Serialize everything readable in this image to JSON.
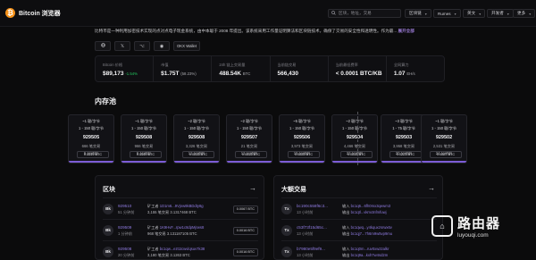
{
  "header": {
    "logo_glyph": "₿",
    "app_name": "Bitcoin 浏览器",
    "search_placeholder": "区块，地址，交易",
    "dropdowns": [
      {
        "label": "区块链"
      },
      {
        "label": "Rumes"
      },
      {
        "label": "英文"
      },
      {
        "label": "开发者"
      },
      {
        "label": "更多"
      }
    ]
  },
  "description": {
    "text": "比特币是一种利用加密技术实现的点对点电子现金系统，由中本聪于 2008 年提出。该系统采用工作量证明算法和区块链技术，确保了交易的安全性和透明性。作为最...",
    "more_label": "展开全部"
  },
  "social": {
    "x_glyph": "𝕏",
    "github_glyph": "⌥",
    "discord_glyph": "◉",
    "okx_label": "OKX Wallet"
  },
  "stats": [
    {
      "label": "Bitcoin 价格",
      "value": "$89,173",
      "delta": "-1.54%"
    },
    {
      "label": "市值",
      "value": "$1.75T",
      "unit": "(58.23%)"
    },
    {
      "label": "24h 链上交易量",
      "value": "488.54K",
      "unit": "BTC"
    },
    {
      "label": "当前链交易",
      "value": "566,430"
    },
    {
      "label": "当前最低费率",
      "value": "< 0.0001 BTC/KB"
    },
    {
      "label": "全网算力",
      "value": "1.07",
      "unit": "EH/s"
    }
  ],
  "mempool": {
    "title": "内存池",
    "blocks": [
      {
        "l1": "~1 聪/字节",
        "l2": "1 - 150 聪/字节",
        "num": "929505",
        "l4": "666 笔交易",
        "l5": "5 分钟前",
        "fee": "0.0059 BTC"
      },
      {
        "l1": "~1 聪/字节",
        "l2": "1 - 150 聪/字节",
        "num": "929508",
        "l4": "966 笔交易",
        "l5": "5 分钟前",
        "fee": "0.0069 BTC"
      },
      {
        "l1": "~2 聪/字节",
        "l2": "1 - 150 聪/字节",
        "num": "929508",
        "l4": "3,326 笔交易",
        "l5": "12 分钟前",
        "fee": "0.0016 BTC"
      },
      {
        "l1": "~2 聪/字节",
        "l2": "1 - 150 聪/字节",
        "num": "929507",
        "l4": "21 笔交易",
        "l5": "12 分钟前",
        "fee": "0.0016 BTC"
      },
      {
        "l1": "~5 聪/字节",
        "l2": "1 - 150 聪/字节",
        "num": "929506",
        "l4": "3,973 笔交易",
        "l5": "15 分钟前",
        "fee": "0.0039 BTC"
      },
      {
        "l1": "~2 聪/字节",
        "l2": "1 - 150 聪/字节",
        "num": "929504",
        "l4": "4,466 笔交易",
        "l5": "22 分钟前",
        "fee": "0.0016 BTC"
      },
      {
        "l1": "~3 聪/字节",
        "l2": "1 - 75 聪/字节",
        "num": "929503",
        "l4": "3,958 笔交易",
        "l5": "20 分钟前",
        "fee": "0.0223 BTC"
      },
      {
        "l1": "~1 聪/字节",
        "l2": "1 - 150 聪/字节",
        "num": "929502",
        "l4": "2,531 笔交易",
        "l5": "24 分钟前",
        "fee": "0.0087 BTC"
      }
    ]
  },
  "blocks_panel": {
    "title": "区块",
    "arrow": "→",
    "rows": [
      {
        "icon": "Bk",
        "height": "929510",
        "age": "51 分钟前",
        "miner_prefix": "矿工者",
        "miner": "1D1m6...9Vjnw9kBDdty8g",
        "txs": "3,155 笔交易",
        "reward": "3.1317468 BTC",
        "fee": "0.0067 BTC"
      },
      {
        "icon": "Bk",
        "height": "929509",
        "age": "1 分钟前",
        "miner_prefix": "矿工者",
        "miner": "1K9HvF...rpw1c8dpMjrws8",
        "txs": "968 笔交易",
        "reward": "3.131187105 BTC",
        "fee": "0.0016 BTC"
      },
      {
        "icon": "Bk",
        "height": "929508",
        "age": "20 分钟前",
        "miner_prefix": "矿工者",
        "miner": "bc1qw...ezt1tcwvlqsuv7k38",
        "txs": "3,180 笔交易",
        "reward": "3.1263 BTC",
        "fee": "0.0016 BTC"
      }
    ]
  },
  "tx_panel": {
    "title": "大额交易",
    "arrow": "→",
    "rows": [
      {
        "icon": "Tx",
        "hash": "bc190c558f6c3...",
        "age": "13 小时前",
        "in_label": "输入",
        "in_addr": "bc1q6...6fh0mx3qewm3",
        "out_label": "输出",
        "out_addr": "bc1qtl...vkmctnfmfuwj"
      },
      {
        "icon": "Tx",
        "hash": "c53f73f15d65c...",
        "age": "13 小时前",
        "in_label": "输入",
        "in_addr": "bc1qwq...y4kquxzsrwx6v",
        "out_label": "输出",
        "out_addr": "bc1qj7...7h6m9w5vp9mu"
      },
      {
        "icon": "Tx",
        "hash": "b7980e5f9ef9...",
        "age": "13 小时前",
        "in_label": "输入",
        "in_addr": "bc1q0m...ruv0xwz2alkr",
        "out_label": "输出",
        "out_addr": "bc1q9a...kxh7w4sd2m"
      }
    ]
  },
  "watermark": {
    "box_glyph": "⌂",
    "title": "路由器",
    "url": "luyouqi.com"
  }
}
